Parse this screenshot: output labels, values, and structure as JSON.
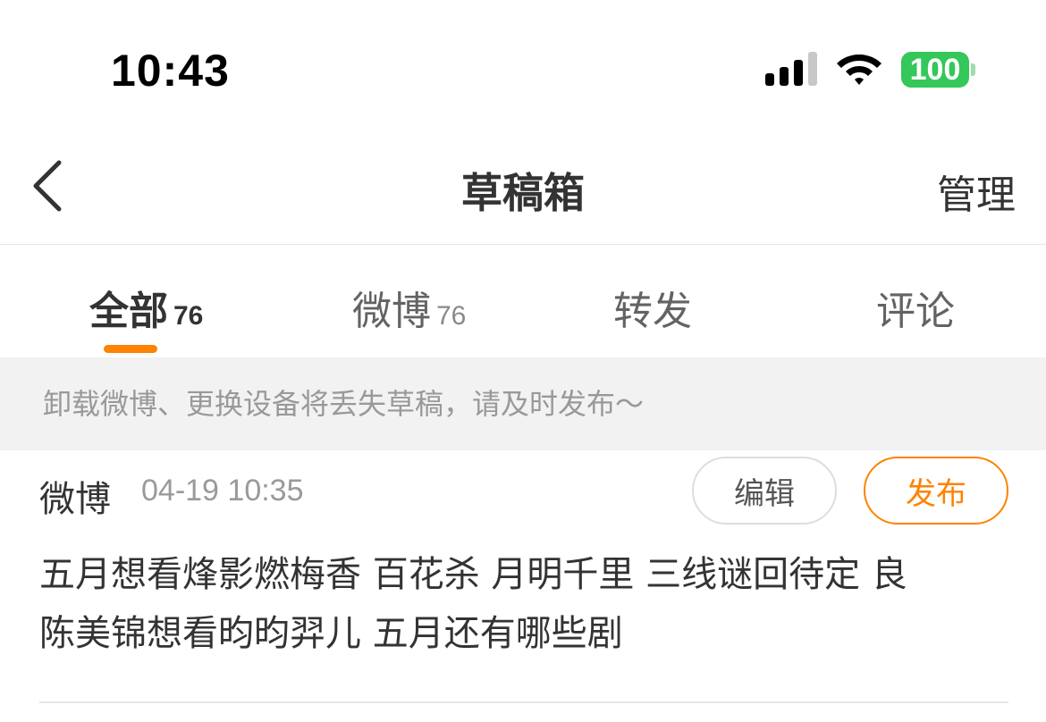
{
  "status_bar": {
    "time": "10:43",
    "battery_level": "100",
    "battery_color": "#34c759",
    "signal_icon": "cellular-signal-icon",
    "wifi_icon": "wifi-icon"
  },
  "nav": {
    "back_icon": "chevron-left-icon",
    "title": "草稿箱",
    "manage_label": "管理"
  },
  "tabs": [
    {
      "label": "全部",
      "count": "76",
      "active": true
    },
    {
      "label": "微博",
      "count": "76",
      "active": false
    },
    {
      "label": "转发",
      "count": "",
      "active": false
    },
    {
      "label": "评论",
      "count": "",
      "active": false
    }
  ],
  "accent_color": "#ff8200",
  "notice": "卸载微博、更换设备将丢失草稿，请及时发布～",
  "drafts": [
    {
      "type": "微博",
      "time": "04-19 10:35",
      "edit_label": "编辑",
      "publish_label": "发布",
      "content_line1": "五月想看烽影燃梅香 百花杀 月明千里 三线谜回待定 良",
      "content_line2": "陈美锦想看昀昀羿儿 五月还有哪些剧"
    }
  ]
}
